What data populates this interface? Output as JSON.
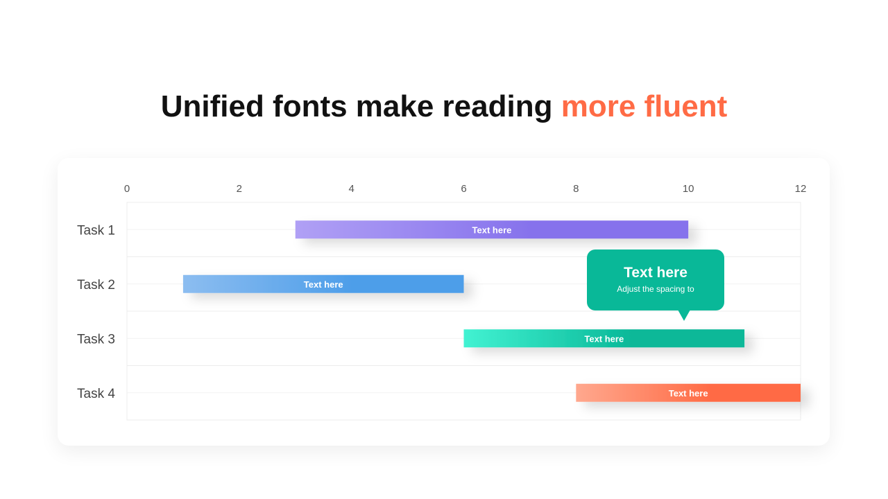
{
  "title": {
    "main": "Unified fonts make reading ",
    "accent": "more fluent",
    "accent_color": "#ff6b45"
  },
  "callout": {
    "title": "Text here",
    "text": "Adjust the spacing to",
    "color": "#09b898"
  },
  "chart_data": {
    "type": "gantt",
    "x_ticks": [
      "0",
      "2",
      "4",
      "6",
      "8",
      "10",
      "12"
    ],
    "xlim": [
      0,
      12
    ],
    "grid": true,
    "categories": [
      "Task 1",
      "Task 2",
      "Task 3",
      "Task 4"
    ],
    "tasks": [
      {
        "name": "Task 1",
        "start": 3,
        "end": 10,
        "label": "Text here",
        "color_from": "#b0a0f5",
        "color_to": "#8672ec"
      },
      {
        "name": "Task 2",
        "start": 1,
        "end": 6,
        "label": "Text here",
        "color_from": "#8cbdf0",
        "color_to": "#4e9ee9"
      },
      {
        "name": "Task 3",
        "start": 6,
        "end": 11,
        "label": "Text here",
        "color_from": "#42f2d2",
        "color_to": "#09b898"
      },
      {
        "name": "Task 4",
        "start": 8,
        "end": 12,
        "label": "Text here",
        "color_from": "#ffa88e",
        "color_to": "#ff6b45"
      }
    ]
  }
}
